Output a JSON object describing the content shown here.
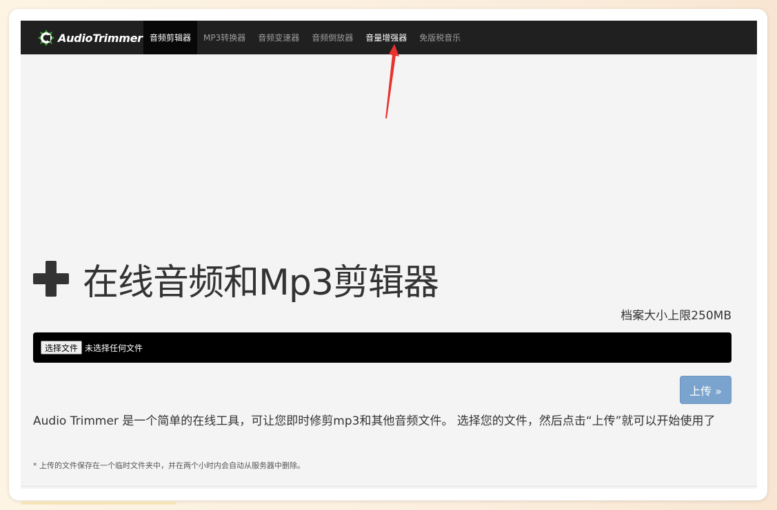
{
  "brand": {
    "name": "AudioTrimmer",
    "icon": "audiotrimmer-logo-icon",
    "accent_color": "#3aa335"
  },
  "nav": {
    "items": [
      {
        "label": "音频剪辑器",
        "state": "active"
      },
      {
        "label": "MP3转换器",
        "state": "normal"
      },
      {
        "label": "音频变速器",
        "state": "normal"
      },
      {
        "label": "音频倒放器",
        "state": "normal"
      },
      {
        "label": "音量增强器",
        "state": "highlight"
      },
      {
        "label": "免版税音乐",
        "state": "normal"
      }
    ]
  },
  "annotation": {
    "icon": "red-arrow-icon",
    "color": "#e8322e"
  },
  "main": {
    "headline_icon": "plus-icon",
    "headline": "在线音频和Mp3剪辑器",
    "size_limit": "档案大小上限250MB",
    "file_input": {
      "button_label": "选择文件",
      "status": "未选择任何文件"
    },
    "upload_label": "上传 »",
    "upload_color": "#7aa4cd",
    "description": "Audio Trimmer 是一个简单的在线工具，可让您即时修剪mp3和其他音频文件。 选择您的文件，然后点击“上传”就可以开始使用了",
    "note": "* 上传的文件保存在一个临时文件夹中，并在两个小时内会自动从服务器中删除。"
  }
}
